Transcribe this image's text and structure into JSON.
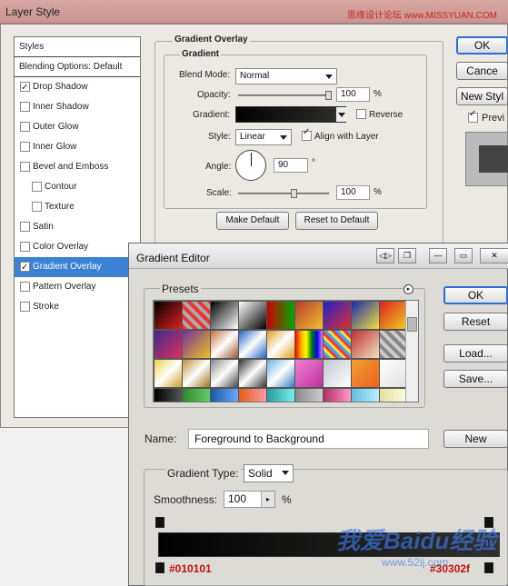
{
  "layer_style": {
    "title": "Layer Style",
    "watermark": "思缘设计论坛 www.MISSYUAN.COM",
    "styles_list": [
      {
        "label": "Styles",
        "checkbox": false,
        "header": true
      },
      {
        "label": "Blending Options: Default",
        "checkbox": false,
        "header": true
      },
      {
        "label": "Drop Shadow",
        "checkbox": true,
        "checked": true
      },
      {
        "label": "Inner Shadow",
        "checkbox": true,
        "checked": false
      },
      {
        "label": "Outer Glow",
        "checkbox": true,
        "checked": false
      },
      {
        "label": "Inner Glow",
        "checkbox": true,
        "checked": false
      },
      {
        "label": "Bevel and Emboss",
        "checkbox": true,
        "checked": false
      },
      {
        "label": "Contour",
        "checkbox": true,
        "checked": false,
        "indent": true
      },
      {
        "label": "Texture",
        "checkbox": true,
        "checked": false,
        "indent": true
      },
      {
        "label": "Satin",
        "checkbox": true,
        "checked": false
      },
      {
        "label": "Color Overlay",
        "checkbox": true,
        "checked": false
      },
      {
        "label": "Gradient Overlay",
        "checkbox": true,
        "checked": true,
        "selected": true
      },
      {
        "label": "Pattern Overlay",
        "checkbox": true,
        "checked": false
      },
      {
        "label": "Stroke",
        "checkbox": true,
        "checked": false
      }
    ],
    "section_title": "Gradient Overlay",
    "group_title": "Gradient",
    "blend_mode_label": "Blend Mode:",
    "blend_mode_value": "Normal",
    "opacity_label": "Opacity:",
    "opacity_value": "100",
    "opacity_unit": "%",
    "opacity_fraction": 1.0,
    "gradient_label": "Gradient:",
    "reverse_label": "Reverse",
    "style_label": "Style:",
    "style_value": "Linear",
    "align_label": "Align with Layer",
    "angle_label": "Angle:",
    "angle_value": "90",
    "angle_unit": "°",
    "scale_label": "Scale:",
    "scale_value": "100",
    "scale_unit": "%",
    "make_default": "Make Default",
    "reset_default": "Reset to Default",
    "ok": "OK",
    "cancel": "Cance",
    "new_style": "New Styl",
    "preview": "Previ"
  },
  "gradient_editor": {
    "title": "Gradient Editor",
    "presets_label": "Presets",
    "ok": "OK",
    "reset": "Reset",
    "load": "Load...",
    "save": "Save...",
    "name_label": "Name:",
    "name_value": "Foreground to Background",
    "new_button": "New",
    "gradient_type_label": "Gradient Type:",
    "gradient_type_value": "Solid",
    "smoothness_label": "Smoothness:",
    "smoothness_value": "100",
    "smoothness_unit": "%",
    "stop_left_hex": "#010101",
    "stop_right_hex": "#30302f",
    "watermark_logo": "我爱Baidu经验",
    "watermark_url": "www.52ij.com",
    "colors": {
      "left": "#010101",
      "right": "#30302f",
      "accent": "#3b82d6"
    },
    "presets": [
      [
        "linear-gradient(135deg,#000,#e02020)",
        "repeating-linear-gradient(45deg,#e33 0 4px,#aaa 4px 8px)",
        "linear-gradient(135deg,#000,#fff)",
        "linear-gradient(135deg,#fff,#000)",
        "linear-gradient(90deg,#c00,#0a0)",
        "linear-gradient(135deg,#b83a2d,#f0c030)",
        "linear-gradient(135deg,#2020d0,#e03030)",
        "linear-gradient(135deg,#1a2ab0,#f4e03a)",
        "linear-gradient(135deg,#e02020,#f0d020)"
      ],
      [
        "linear-gradient(135deg,#3a2a8a,#e03060)",
        "linear-gradient(135deg,#7030a0,#f0c020)",
        "linear-gradient(135deg,#c07040,#fff 50%,#a05030)",
        "linear-gradient(135deg,#2060c0,#fff 50%,#2060c0)",
        "linear-gradient(135deg,#e0a020,#fff 50%,#e0a020)",
        "linear-gradient(90deg,red,orange,yellow,green,blue,violet)",
        "repeating-linear-gradient(45deg,#f33 0 3px,#3af 3px 6px,#fd3 6px 9px)",
        "linear-gradient(135deg,#c03030,#f0e0c0)",
        "repeating-linear-gradient(45deg,#888 0 4px,#ccc 4px 8px)"
      ],
      [
        "linear-gradient(135deg,#f0d040,#fff 50%,#d0a020)",
        "linear-gradient(135deg,#c09030,#fff 50%,#a07020)",
        "linear-gradient(135deg,#888,#fff 50%,#444)",
        "linear-gradient(135deg,#333,#fff 50%,#333)",
        "linear-gradient(135deg,#6ab0e0,#fff 50%,#3080c0)",
        "linear-gradient(135deg,#f080d0,#c030a0)",
        "linear-gradient(135deg,#c0c8d0,#fff)",
        "linear-gradient(135deg,#f0a030,#f06020)",
        "linear-gradient(135deg,#fff,#e0e0e0)"
      ],
      [
        "linear-gradient(90deg,#000,#555)",
        "linear-gradient(90deg,#2a8a2a,#6c6)",
        "linear-gradient(90deg,#1a5aa0,#6af)",
        "linear-gradient(90deg,#e06010,#f9a)",
        "linear-gradient(90deg,#2a9aa0,#7ee)",
        "linear-gradient(90deg,#888,#ccc)",
        "linear-gradient(90deg,#b03060,#f9c)",
        "linear-gradient(90deg,#60c0e0,#bef)",
        "linear-gradient(90deg,#e0e0a0,#ffd)"
      ]
    ]
  }
}
